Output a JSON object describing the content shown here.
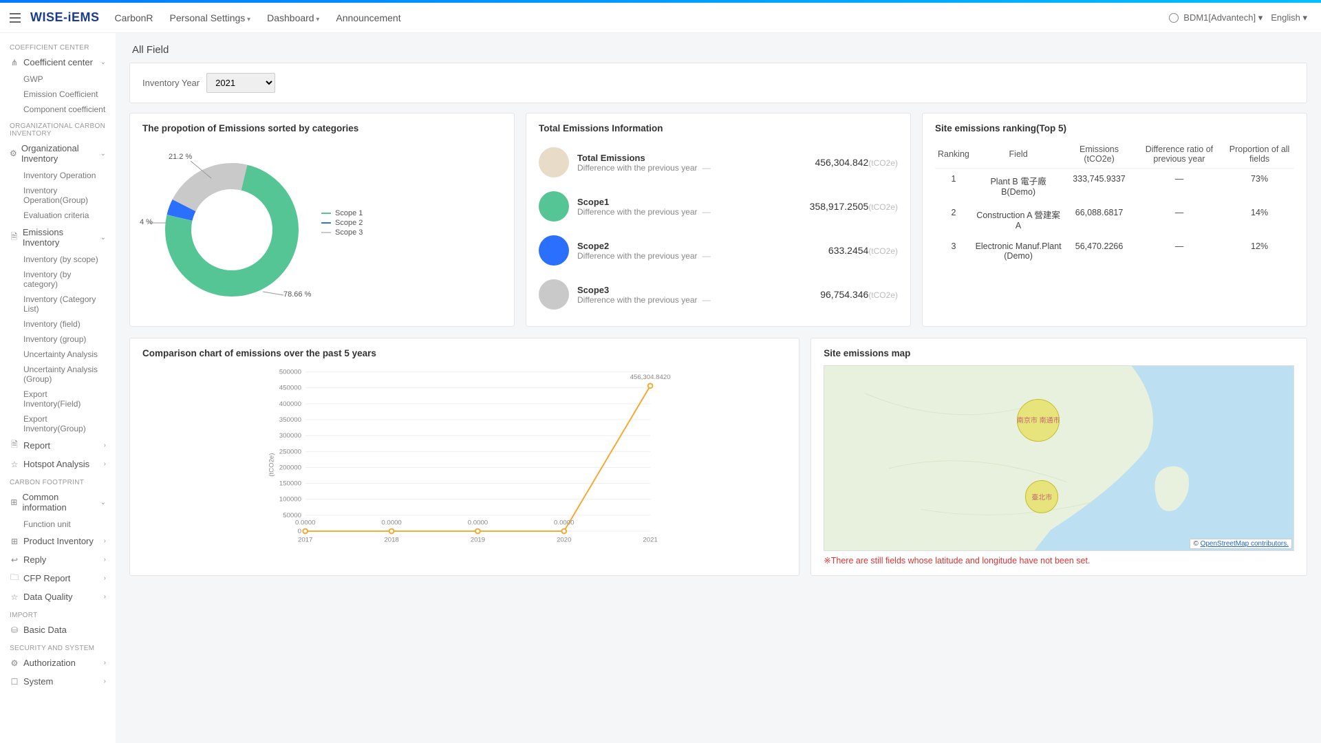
{
  "header": {
    "logo": "WISE-iEMS",
    "nav": [
      "CarbonR",
      "Personal Settings",
      "Dashboard",
      "Announcement"
    ],
    "nav_has_caret": [
      false,
      true,
      true,
      false
    ],
    "user": "BDM1[Advantech]",
    "language": "English"
  },
  "sidebar": {
    "sections": [
      {
        "label": "COEFFICIENT CENTER",
        "items": [
          {
            "label": "Coefficient center",
            "icon": "share",
            "expandable": true,
            "open": true,
            "subs": [
              "GWP",
              "Emission Coefficient",
              "Component coefficient"
            ]
          }
        ]
      },
      {
        "label": "ORGANIZATIONAL CARBON INVENTORY",
        "items": [
          {
            "label": "Organizational Inventory",
            "icon": "gear",
            "expandable": true,
            "open": true,
            "subs": [
              "Inventory Operation",
              "Inventory Operation(Group)",
              "Evaluation criteria"
            ]
          },
          {
            "label": "Emissions Inventory",
            "icon": "doc",
            "expandable": true,
            "open": true,
            "subs": [
              "Inventory (by scope)",
              "Inventory (by category)",
              "Inventory (Category List)",
              "Inventory (field)",
              "Inventory (group)",
              "Uncertainty Analysis",
              "Uncertainty Analysis (Group)",
              "Export Inventory(Field)",
              "Export Inventory(Group)"
            ]
          },
          {
            "label": "Report",
            "icon": "doc",
            "expandable": true,
            "open": false,
            "subs": []
          },
          {
            "label": "Hotspot Analysis",
            "icon": "star",
            "expandable": true,
            "open": false,
            "subs": []
          }
        ]
      },
      {
        "label": "CARBON FOOTPRINT",
        "items": [
          {
            "label": "Common information",
            "icon": "grid",
            "expandable": true,
            "open": true,
            "subs": [
              "Function unit"
            ]
          },
          {
            "label": "Product Inventory",
            "icon": "grid",
            "expandable": true,
            "open": false,
            "subs": []
          },
          {
            "label": "Reply",
            "icon": "reply",
            "expandable": true,
            "open": false,
            "subs": []
          },
          {
            "label": "CFP Report",
            "icon": "folder",
            "expandable": true,
            "open": false,
            "subs": []
          },
          {
            "label": "Data Quality",
            "icon": "star",
            "expandable": true,
            "open": false,
            "subs": []
          }
        ]
      },
      {
        "label": "IMPORT",
        "items": [
          {
            "label": "Basic Data",
            "icon": "db",
            "expandable": false,
            "open": false,
            "subs": []
          }
        ]
      },
      {
        "label": "SECURITY AND SYSTEM",
        "items": [
          {
            "label": "Authorization",
            "icon": "gear",
            "expandable": true,
            "open": false,
            "subs": []
          },
          {
            "label": "System",
            "icon": "box",
            "expandable": true,
            "open": false,
            "subs": []
          }
        ]
      }
    ]
  },
  "page": {
    "title": "All Field",
    "filter_label": "Inventory Year",
    "filter_value": "2021"
  },
  "cards": {
    "proportion_title": "The propotion of Emissions sorted by categories",
    "total_title": "Total Emissions Information",
    "ranking_title": "Site emissions ranking(Top 5)",
    "comparison_title": "Comparison chart of emissions over the past 5 years",
    "map_title": "Site emissions map"
  },
  "donut": {
    "legend": [
      {
        "name": "Scope 1",
        "color": "#56c596"
      },
      {
        "name": "Scope 2",
        "color": "#2b6fff"
      },
      {
        "name": "Scope 3",
        "color": "#c9c9c9"
      }
    ],
    "labels": [
      "21.2 %",
      "4 %",
      "78.66 %"
    ]
  },
  "emissions": {
    "diff_label": "Difference with the previous year",
    "unit": "(tCO2e)",
    "rows": [
      {
        "name": "Total Emissions",
        "value": "456,304.842",
        "color": "#e8dcc8"
      },
      {
        "name": "Scope1",
        "value": "358,917.2505",
        "color": "#56c596"
      },
      {
        "name": "Scope2",
        "value": "633.2454",
        "color": "#2b6fff"
      },
      {
        "name": "Scope3",
        "value": "96,754.346",
        "color": "#c9c9c9"
      }
    ]
  },
  "ranking": {
    "headers": [
      "Ranking",
      "Field",
      "Emissions (tCO2e)",
      "Difference ratio of previous year",
      "Proportion of all fields"
    ],
    "rows": [
      {
        "rank": "1",
        "field": "Plant B 電子廠B(Demo)",
        "emissions": "333,745.9337",
        "diff": "—",
        "prop": "73%"
      },
      {
        "rank": "2",
        "field": "Construction A 營建案A",
        "emissions": "66,088.6817",
        "diff": "—",
        "prop": "14%"
      },
      {
        "rank": "3",
        "field": "Electronic Manuf.Plant (Demo)",
        "emissions": "56,470.2266",
        "diff": "—",
        "prop": "12%"
      }
    ]
  },
  "chart_data": {
    "type": "line",
    "title": "Comparison chart of emissions over the past 5 years",
    "xlabel": "",
    "ylabel": "(tCO2e)",
    "ylim": [
      0,
      500000
    ],
    "categories": [
      "2017",
      "2018",
      "2019",
      "2020",
      "2021"
    ],
    "values": [
      0,
      0,
      0,
      0,
      456304.842
    ],
    "point_labels": [
      "0.0000",
      "0.0000",
      "0.0000",
      "0.0000",
      "456,304.8420"
    ]
  },
  "map": {
    "note": "※There are still fields whose latitude and longitude have not been set.",
    "attrib_prefix": "© ",
    "attrib_link": "OpenStreetMap contributors.",
    "bubble_labels": [
      "南京市 南通市",
      "臺北市"
    ]
  }
}
